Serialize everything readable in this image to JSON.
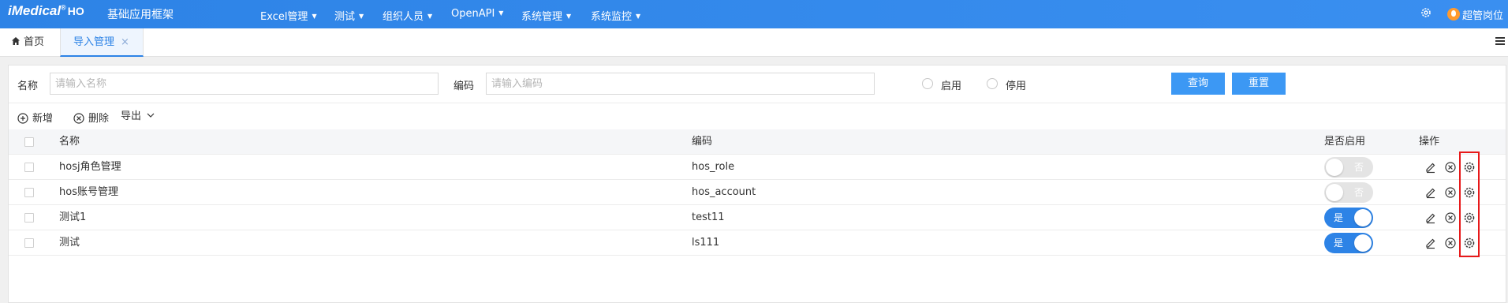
{
  "header": {
    "logo": "iMedical",
    "logo_reg": "®",
    "logo_suffix": "HO",
    "app_title": "基础应用框架",
    "menus": [
      {
        "label": "Excel管理"
      },
      {
        "label": "测试"
      },
      {
        "label": "组织人员"
      },
      {
        "label": "OpenAPI"
      },
      {
        "label": "系统管理"
      },
      {
        "label": "系统监控"
      }
    ],
    "user_role": "超管岗位",
    "icons": {
      "settings": "gear-icon",
      "user": "user-badge-icon"
    }
  },
  "tabs": [
    {
      "label": "首页",
      "icon": "home-icon"
    },
    {
      "label": "导入管理",
      "close": "×",
      "active": true
    }
  ],
  "search": {
    "name_label": "名称",
    "name_placeholder": "请输入名称",
    "code_label": "编码",
    "code_placeholder": "请输入编码",
    "enabled_label": "启用",
    "disabled_label": "停用",
    "query_button": "查询",
    "reset_button": "重置"
  },
  "toolbar": {
    "add_label": "新增",
    "delete_label": "删除",
    "export_label": "导出"
  },
  "table": {
    "columns": {
      "name": "名称",
      "code": "编码",
      "status": "是否启用",
      "ops": "操作"
    },
    "rows": [
      {
        "name": "hosj角色管理",
        "code": "hos_role",
        "enabled": false,
        "status_text": "否"
      },
      {
        "name": "hos账号管理",
        "code": "hos_account",
        "enabled": false,
        "status_text": "否"
      },
      {
        "name": "测试1",
        "code": "test11",
        "enabled": true,
        "status_text": "是"
      },
      {
        "name": "测试",
        "code": "ls111",
        "enabled": true,
        "status_text": "是"
      }
    ]
  },
  "colors": {
    "primary": "#2d83e6",
    "button": "#3c98f4",
    "highlight_box": "#e8191a",
    "user_badge": "#ff9a2e"
  }
}
